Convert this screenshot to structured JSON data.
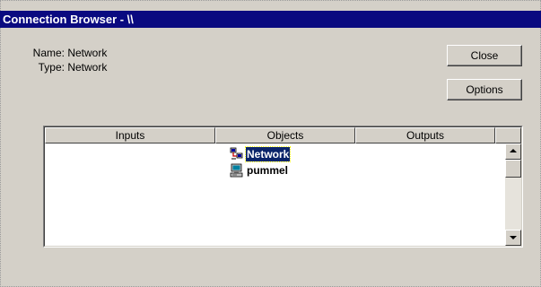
{
  "window": {
    "title": "Connection Browser - \\\\"
  },
  "info": {
    "name_label": "Name:",
    "name_value": "Network",
    "type_label": "Type:",
    "type_value": "Network"
  },
  "buttons": {
    "close": "Close",
    "options": "Options"
  },
  "list": {
    "columns": [
      "Inputs",
      "Objects",
      "Outputs"
    ],
    "items": [
      {
        "label": "Network",
        "icon": "network-icon",
        "selected": true
      },
      {
        "label": "pummel",
        "icon": "computer-icon",
        "selected": false
      }
    ]
  },
  "colors": {
    "titlebar": "#0a0a80",
    "window_bg": "#d4d0c8",
    "selection": "#0a246a"
  }
}
